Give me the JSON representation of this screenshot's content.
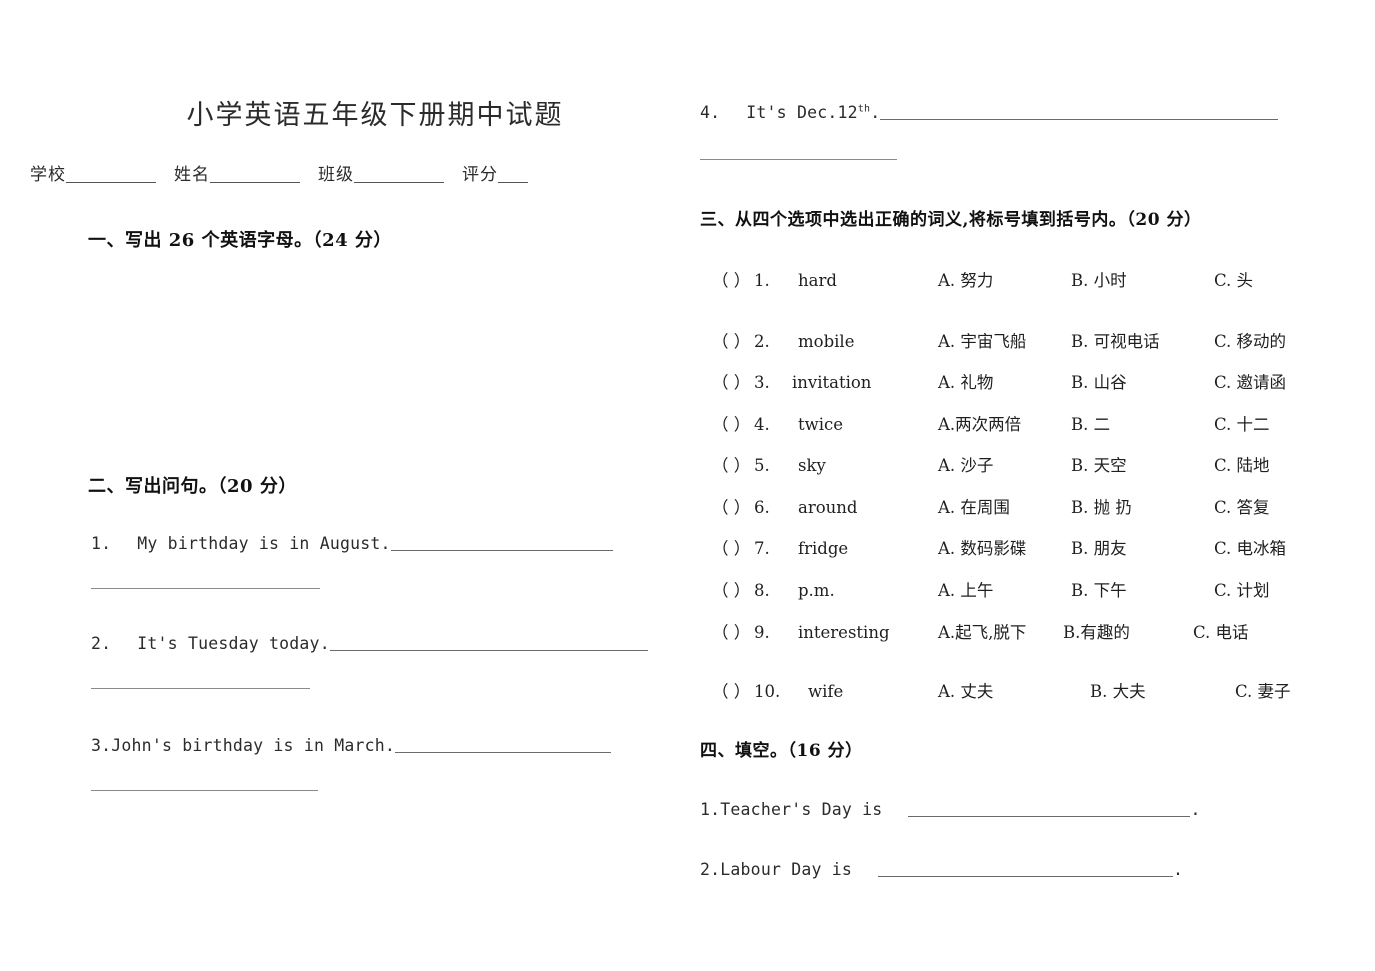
{
  "document": {
    "title": "小学英语五年级下册期中试题"
  },
  "identity": {
    "school_label": "学校",
    "name_label": "姓名",
    "class_label": "班级",
    "score_label": "评分"
  },
  "sections": {
    "one": {
      "heading": "一、写出 26 个英语字母。（24 分）"
    },
    "two": {
      "heading": "二、写出问句。（20 分）",
      "items": [
        {
          "number": "1.",
          "text": "My   birthday   is   in   August."
        },
        {
          "number": "2.",
          "text": "It's   Tuesday   today."
        },
        {
          "number": "3.",
          "text": "John's   birthday   is   in   March."
        }
      ],
      "item4": {
        "number": "4.",
        "text_pre": "It's   Dec.12",
        "sup": "th",
        "text_post": "."
      }
    },
    "three": {
      "heading": "三、从四个选项中选出正确的词义,将标号填到括号内。（20 分）",
      "paren": "（   ）",
      "items": [
        {
          "number": "1.",
          "word": "hard",
          "a": "A.   努力",
          "b": "B.   小时",
          "c": "C.   头"
        },
        {
          "number": "2.",
          "word": "mobile",
          "a": "A. 宇宙飞船",
          "b": "B. 可视电话",
          "c": "C.  移动的"
        },
        {
          "number": "3.",
          "word": "invitation",
          "a": "A.  礼物",
          "b": "B.   山谷",
          "c": "C.   邀请函"
        },
        {
          "number": "4.",
          "word": "twice",
          "a": "A.两次两倍",
          "b": "B.  二",
          "c": "C.  十二"
        },
        {
          "number": "5.",
          "word": "sky",
          "a": "A.   沙子",
          "b": "B.   天空",
          "c": "C.  陆地"
        },
        {
          "number": "6.",
          "word": "around",
          "a": "A. 在周围",
          "b": "B. 抛 扔",
          "c": "C. 答复"
        },
        {
          "number": "7.",
          "word": "fridge",
          "a": "A. 数码影碟",
          "b": "B. 朋友",
          "c": "C.  电冰箱"
        },
        {
          "number": "8.",
          "word": "p.m.",
          "a": "A. 上午",
          "b": "B.  下午",
          "c": "C.  计划"
        },
        {
          "number": "9.",
          "word": "interesting",
          "a": "A.起飞,脱下",
          "b": "B.有趣的",
          "c": "C.  电话"
        },
        {
          "number": "10.",
          "word": "wife",
          "a": "A.   丈夫",
          "b": "B. 大夫",
          "c": "C.   妻子"
        }
      ]
    },
    "four": {
      "heading": "四、填空。（16 分）",
      "items": [
        {
          "number": "1.",
          "text": "Teacher's   Day     is",
          "period": "."
        },
        {
          "number": "2.",
          "text": "Labour   Day      is",
          "period": "."
        }
      ]
    }
  }
}
